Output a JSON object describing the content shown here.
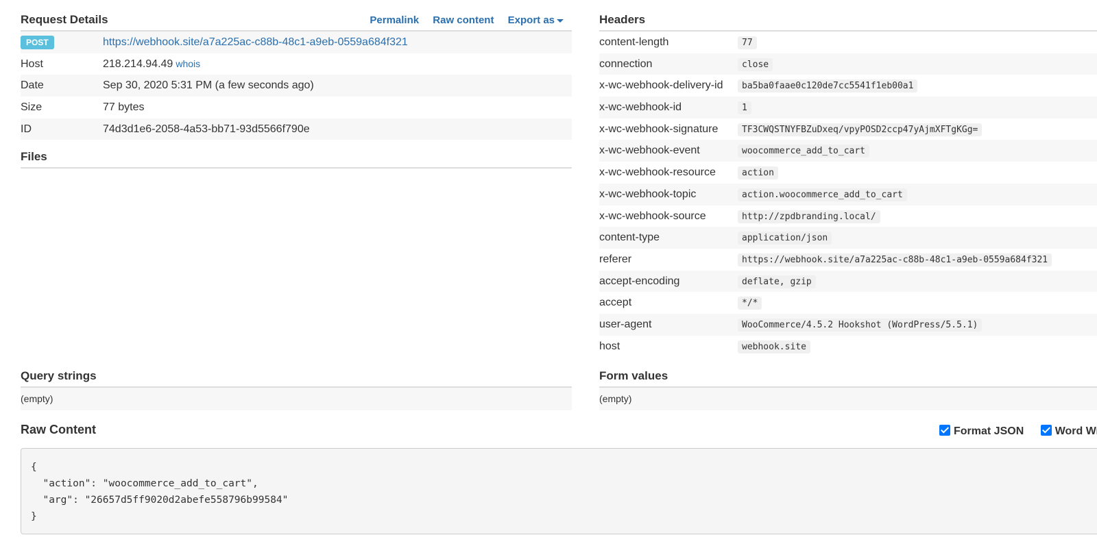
{
  "request_details": {
    "title": "Request Details",
    "links": {
      "permalink": "Permalink",
      "raw_content": "Raw content",
      "export_as": "Export as"
    },
    "method": "POST",
    "url": "https://webhook.site/a7a225ac-c88b-48c1-a9eb-0559a684f321",
    "host_label": "Host",
    "host_value": "218.214.94.49",
    "whois": "whois",
    "date_label": "Date",
    "date_value": "Sep 30, 2020 5:31 PM (a few seconds ago)",
    "size_label": "Size",
    "size_value": "77 bytes",
    "id_label": "ID",
    "id_value": "74d3d1e6-2058-4a53-bb71-93d5566f790e"
  },
  "files": {
    "title": "Files"
  },
  "headers": {
    "title": "Headers",
    "rows": [
      {
        "key": "content-length",
        "value": "77"
      },
      {
        "key": "connection",
        "value": "close"
      },
      {
        "key": "x-wc-webhook-delivery-id",
        "value": "ba5ba0faae0c120de7cc5541f1eb00a1"
      },
      {
        "key": "x-wc-webhook-id",
        "value": "1"
      },
      {
        "key": "x-wc-webhook-signature",
        "value": "TF3CWQSTNYFBZuDxeq/vpyPOSD2ccp47yAjmXFTgKGg="
      },
      {
        "key": "x-wc-webhook-event",
        "value": "woocommerce_add_to_cart"
      },
      {
        "key": "x-wc-webhook-resource",
        "value": "action"
      },
      {
        "key": "x-wc-webhook-topic",
        "value": "action.woocommerce_add_to_cart"
      },
      {
        "key": "x-wc-webhook-source",
        "value": "http://zpdbranding.local/"
      },
      {
        "key": "content-type",
        "value": "application/json"
      },
      {
        "key": "referer",
        "value": "https://webhook.site/a7a225ac-c88b-48c1-a9eb-0559a684f321"
      },
      {
        "key": "accept-encoding",
        "value": "deflate, gzip"
      },
      {
        "key": "accept",
        "value": "*/*"
      },
      {
        "key": "user-agent",
        "value": "WooCommerce/4.5.2 Hookshot (WordPress/5.5.1)"
      },
      {
        "key": "host",
        "value": "webhook.site"
      }
    ]
  },
  "query_strings": {
    "title": "Query strings",
    "value": "(empty)"
  },
  "form_values": {
    "title": "Form values",
    "value": "(empty)"
  },
  "raw_content": {
    "title": "Raw Content",
    "format_json_label": "Format JSON",
    "word_wrap_label": "Word Wrap",
    "lines": [
      "{",
      "  \"action\": \"woocommerce_add_to_cart\",",
      "  \"arg\": \"26657d5ff9020d2abefe558796b99584\"",
      "}"
    ]
  }
}
